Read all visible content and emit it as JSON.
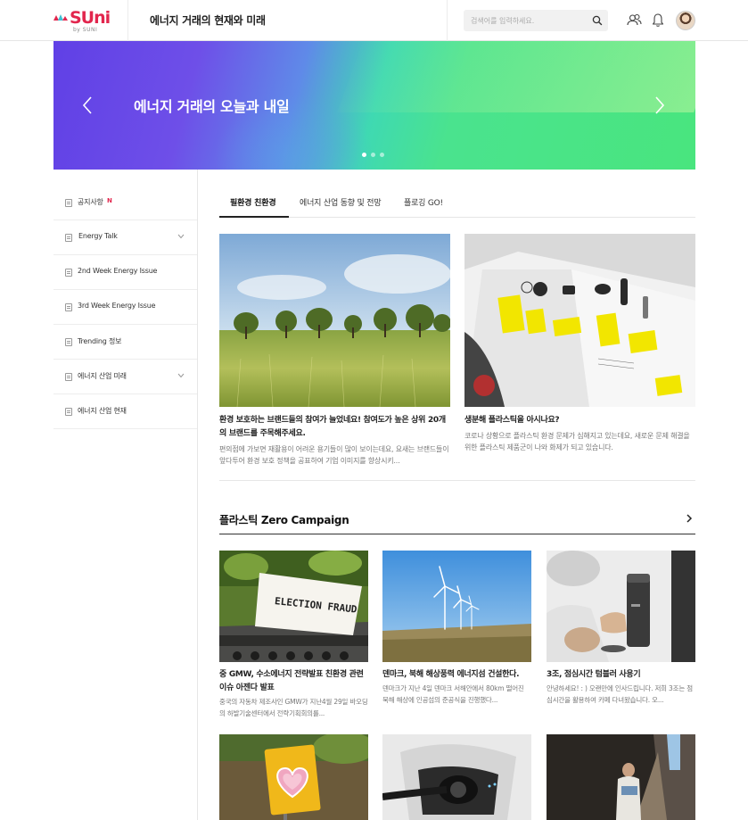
{
  "header": {
    "logo_text": "SUni",
    "logo_sub": "by SUNI",
    "title": "에너지 거래의 현재와 미래",
    "search": {
      "placeholder": "검색어를 입력하세요."
    }
  },
  "banner": {
    "title": "에너지 거래의 오늘과 내일",
    "slides": 3,
    "active_slide": 1
  },
  "sidebar": {
    "items": [
      {
        "label": "공지사항",
        "badge": "N",
        "expandable": false
      },
      {
        "label": "Energy Talk",
        "badge": "",
        "expandable": true
      },
      {
        "label": "2nd Week Energy Issue",
        "badge": "",
        "expandable": false
      },
      {
        "label": "3rd Week Energy Issue",
        "badge": "",
        "expandable": false
      },
      {
        "label": "Trending 정보",
        "badge": "",
        "expandable": false
      },
      {
        "label": "에너지 산업 미래",
        "badge": "",
        "expandable": true
      },
      {
        "label": "에너지 산업 현재",
        "badge": "",
        "expandable": false
      }
    ]
  },
  "tabs": [
    {
      "label": "필환경 친환경",
      "active": true
    },
    {
      "label": "에너지 산업 동향 및 전망",
      "active": false
    },
    {
      "label": "플로깅 GO!",
      "active": false
    }
  ],
  "featured": [
    {
      "title": "환경 보호하는 브랜드들의 참여가 늘었네요! 참여도가 높은 상위 20개의 브랜드를 주목해주세요.",
      "desc": "편의점에 가보면 재활용이 어려운 용기들이 많이 보이는데요, 요새는 브랜드들이 앞다투어 환경 보호 정책을 공표하여 기업 이미지를 향상시키...",
      "image": "field-trees-photo"
    },
    {
      "title": "생분해 플라스틱을 아시나요?",
      "desc": "코로나 상황으로 플라스틱 환경 문제가 심해지고 있는데요, 새로운 문제 해결을 위한 플라스틱 제품군이 나와 화제가 되고 있습니다.",
      "image": "magazine-yellow-products-photo"
    }
  ],
  "section": {
    "title": "플라스틱 Zero Campaign",
    "cards": [
      {
        "title": "중 GMW, 수소에너지 전략발표 친환경 관련 이슈 아젠다 발표",
        "desc": "중국의 자동차 제조사인 GMW가 지난4월 29일 바오딩의 하발기술센터에서 전략기획회의를...",
        "image_text": "ELECTION FRAUD"
      },
      {
        "title": "덴마크, 북해 해상풍력 에너지섬 건설한다.",
        "desc": "덴마크가 지난 4일 덴마크 서해안에서 80km 떨어진 북해 해상에 인공섬의 준공식을 진행했다...",
        "image_text": ""
      },
      {
        "title": "3조, 점심시간 텀블러 사용기",
        "desc": "안녕하세요! : ) 오랜만에 인사드립니다. 저희 3조는 점심시간을 활용하여 카페 다녀왔습니다. 오...",
        "image_text": ""
      }
    ]
  },
  "colors": {
    "brand": "#e2264d",
    "banner_start": "#6040e6",
    "banner_end": "#49e57e"
  }
}
